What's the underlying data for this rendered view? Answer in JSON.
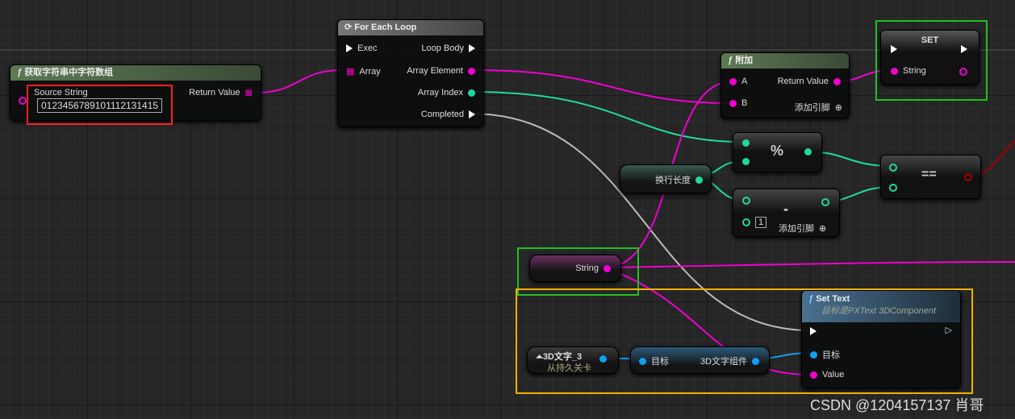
{
  "get_chars": {
    "title": "获取字符串中字符数组",
    "source_label": "Source String",
    "source_value": "0123456789101112131415",
    "return_label": "Return Value"
  },
  "foreach": {
    "title": "For Each Loop",
    "exec": "Exec",
    "array": "Array",
    "loop_body": "Loop Body",
    "array_element": "Array Element",
    "array_index": "Array Index",
    "completed": "Completed"
  },
  "append": {
    "title": "附加",
    "a": "A",
    "b": "B",
    "return_label": "Return Value",
    "add_pin": "添加引脚"
  },
  "set": {
    "title": "SET",
    "string": "String"
  },
  "modulo": {
    "op": "%"
  },
  "equal": {
    "op": "=="
  },
  "subtract": {
    "op": "-",
    "value": "1",
    "add_pin": "添加引脚"
  },
  "line_length": {
    "label": "换行长度"
  },
  "string_var": {
    "label": "String"
  },
  "set_text": {
    "title": "Set Text",
    "subtitle": "目标是PXText 3DComponent",
    "target": "目标",
    "value": "Value"
  },
  "actor_ref": {
    "label": "3D文字_3",
    "sub": "从持久关卡"
  },
  "component_get": {
    "target": "目标",
    "output": "3D文字组件"
  },
  "watermark": "CSDN @1204157137 肖哥",
  "colors": {
    "string_pin": "#f000d0",
    "int_pin": "#20d8a0",
    "object_pin": "#10a0f0",
    "exec": "#ffffff",
    "highlight_red": "#ff2020",
    "highlight_green": "#20c020",
    "highlight_orange": "#f0b000"
  }
}
